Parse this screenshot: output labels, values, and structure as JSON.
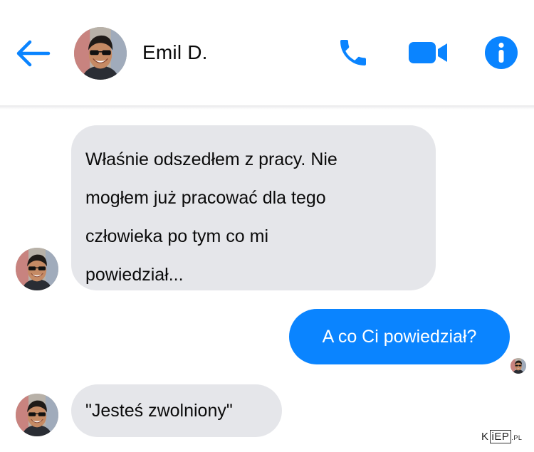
{
  "header": {
    "contact_name": "Emil D.",
    "icons": {
      "back": "arrow-left-icon",
      "call": "phone-icon",
      "video": "video-camera-icon",
      "info": "info-icon"
    }
  },
  "colors": {
    "accent": "#0a84ff",
    "incoming_bubble": "#e5e6ea",
    "outgoing_bubble": "#0a84ff"
  },
  "messages": [
    {
      "direction": "incoming",
      "lines": [
        "Właśnie odszedłem z pracy. Nie",
        "mogłem już pracować dla tego",
        "człowieka po tym co mi",
        "powiedział..."
      ]
    },
    {
      "direction": "outgoing",
      "text": "A co Ci powiedział?"
    },
    {
      "direction": "incoming",
      "text": "\"Jesteś zwolniony\""
    }
  ],
  "watermark": {
    "k": "K",
    "iep": "iEP",
    "pl": ".PL"
  }
}
